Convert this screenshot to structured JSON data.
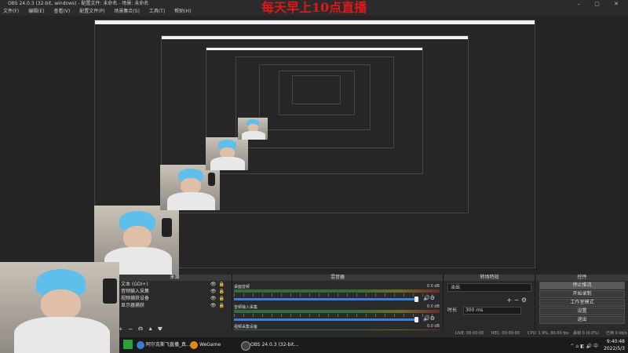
{
  "app": {
    "title": "OBS 24.0.3 (32-bit, windows) - 配置文件: 未命名 - 场景: 未命名",
    "menu": [
      "文件(F)",
      "编辑(E)",
      "查看(V)",
      "配置文件(P)",
      "场景集合(S)",
      "工具(T)",
      "帮助(H)"
    ]
  },
  "overlay_text": "每天早上10点直播",
  "docks": {
    "sources": {
      "header": "来源",
      "items": [
        "文本 (GDI+)",
        "音频输入采集",
        "视频捕获设备",
        "显示器捕获"
      ]
    },
    "mixer": {
      "header": "混音器",
      "tracks": [
        {
          "name": "桌面音频",
          "db": "0.0 dB"
        },
        {
          "name": "音频输入采集",
          "db": "0.0 dB"
        },
        {
          "name": "视频采集设备",
          "db": "0.0 dB"
        }
      ]
    },
    "transitions": {
      "header": "转场特效",
      "selected": "淡出",
      "duration_label": "时长",
      "duration_value": "300 ms"
    },
    "controls": {
      "header": "控件",
      "buttons": [
        "停止推流",
        "开始录制",
        "工作室模式",
        "设置",
        "退出"
      ]
    }
  },
  "status": {
    "live": "LIVE: 00:00:00",
    "rec": "REC: 00:00:00",
    "cpu": "CPU: 1.9%, 60.00 fps",
    "dropped": "丢帧 0 (0.0%)",
    "kbps": "已用 0 kb/s"
  },
  "taskbar": {
    "items": [
      {
        "label": "阿尔克斯飞直播_真...",
        "color": "#3a7bd5"
      },
      {
        "label": "WeGame",
        "color": "#e08a1e"
      },
      {
        "label": "OBS 24.0.3 (32-bit...",
        "color": "#444444"
      }
    ],
    "time": "9:40:48",
    "date": "2022/5/3"
  }
}
